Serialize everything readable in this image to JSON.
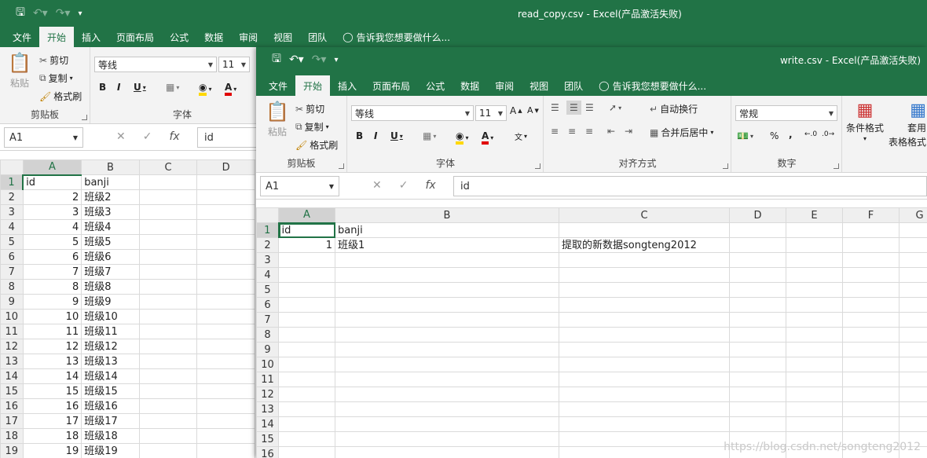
{
  "back": {
    "title": "read_copy.csv  -  Excel(产品激活失败)",
    "tabs": [
      "文件",
      "开始",
      "插入",
      "页面布局",
      "公式",
      "数据",
      "审阅",
      "视图",
      "团队"
    ],
    "tell": "告诉我您想要做什么...",
    "clipboard": {
      "paste": "粘贴",
      "cut": "剪切",
      "copy": "复制",
      "painter": "格式刷",
      "label": "剪贴板"
    },
    "font": {
      "name": "等线",
      "size": "11",
      "label": "字体"
    },
    "namebox": "A1",
    "formula": "id",
    "columns": [
      "A",
      "B",
      "C",
      "D"
    ],
    "rows": [
      [
        "1",
        "id",
        "banji"
      ],
      [
        "2",
        "2",
        "班级2"
      ],
      [
        "3",
        "3",
        "班级3"
      ],
      [
        "4",
        "4",
        "班级4"
      ],
      [
        "5",
        "5",
        "班级5"
      ],
      [
        "6",
        "6",
        "班级6"
      ],
      [
        "7",
        "7",
        "班级7"
      ],
      [
        "8",
        "8",
        "班级8"
      ],
      [
        "9",
        "9",
        "班级9"
      ],
      [
        "10",
        "10",
        "班级10"
      ],
      [
        "11",
        "11",
        "班级11"
      ],
      [
        "12",
        "12",
        "班级12"
      ],
      [
        "13",
        "13",
        "班级13"
      ],
      [
        "14",
        "14",
        "班级14"
      ],
      [
        "15",
        "15",
        "班级15"
      ],
      [
        "16",
        "16",
        "班级16"
      ],
      [
        "17",
        "17",
        "班级17"
      ],
      [
        "18",
        "18",
        "班级18"
      ],
      [
        "19",
        "19",
        "班级19"
      ]
    ]
  },
  "front": {
    "title": "write.csv  -  Excel(产品激活失败)",
    "tabs": [
      "文件",
      "开始",
      "插入",
      "页面布局",
      "公式",
      "数据",
      "审阅",
      "视图",
      "团队"
    ],
    "tell": "告诉我您想要做什么...",
    "clipboard": {
      "paste": "粘贴",
      "cut": "剪切",
      "copy": "复制",
      "painter": "格式刷",
      "label": "剪贴板"
    },
    "font": {
      "name": "等线",
      "size": "11",
      "label": "字体"
    },
    "align": {
      "wrap": "自动换行",
      "merge": "合并后居中",
      "label": "对齐方式"
    },
    "number": {
      "format": "常规",
      "label": "数字"
    },
    "styles": {
      "cond": "条件格式",
      "table1": "套用",
      "table2": "表格格式"
    },
    "namebox": "A1",
    "formula": "id",
    "columns": [
      "A",
      "B",
      "C",
      "D",
      "E",
      "F",
      "G"
    ],
    "rows": [
      [
        "1",
        "id",
        "banji",
        ""
      ],
      [
        "2",
        "1",
        "班级1",
        "提取的新数据songteng2012"
      ],
      [
        "3",
        "",
        "",
        ""
      ],
      [
        "4",
        "",
        "",
        ""
      ],
      [
        "5",
        "",
        "",
        ""
      ],
      [
        "6",
        "",
        "",
        ""
      ],
      [
        "7",
        "",
        "",
        ""
      ],
      [
        "8",
        "",
        "",
        ""
      ],
      [
        "9",
        "",
        "",
        ""
      ],
      [
        "10",
        "",
        "",
        ""
      ],
      [
        "11",
        "",
        "",
        ""
      ],
      [
        "12",
        "",
        "",
        ""
      ],
      [
        "13",
        "",
        "",
        ""
      ],
      [
        "14",
        "",
        "",
        ""
      ],
      [
        "15",
        "",
        "",
        ""
      ],
      [
        "16",
        "",
        "",
        ""
      ]
    ]
  },
  "watermark": "https://blog.csdn.net/songteng2012",
  "colors": {
    "excel_green": "#217346",
    "font_red": "#e00000",
    "fill_yellow": "#ffd800"
  }
}
